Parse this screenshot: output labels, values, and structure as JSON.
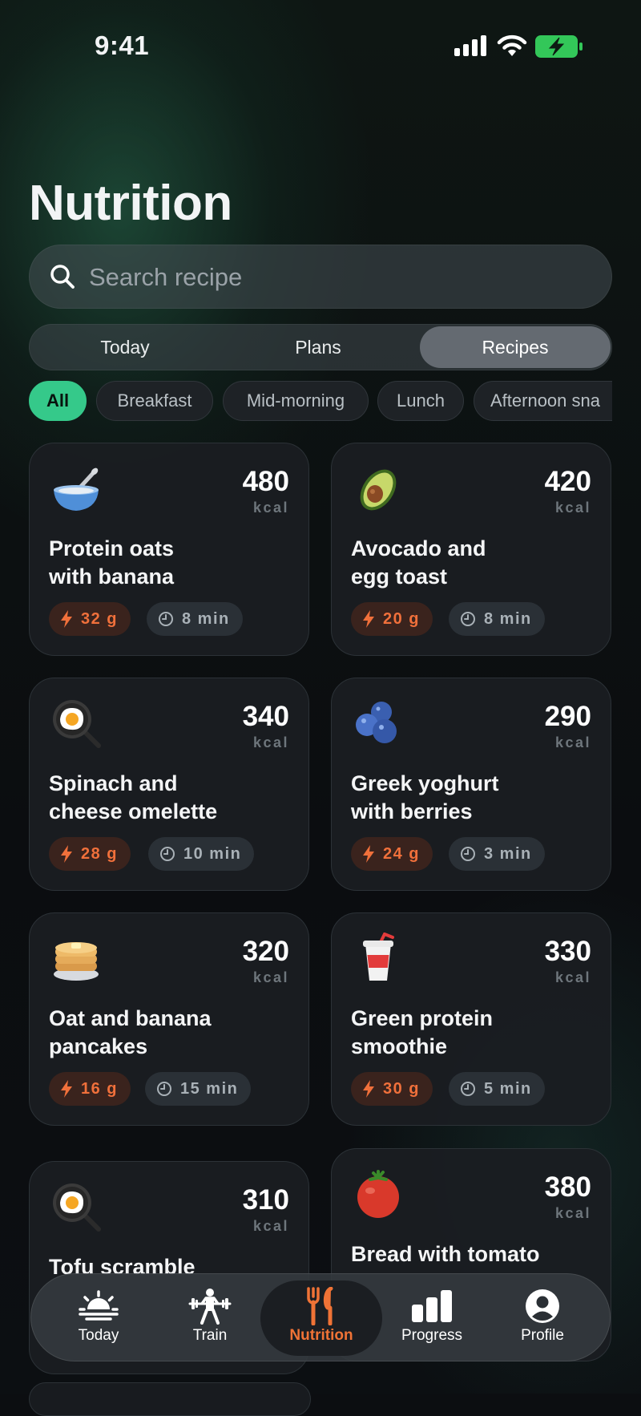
{
  "status_bar": {
    "time": "9:41",
    "icons": [
      "cellular-signal-icon",
      "wifi-icon",
      "battery-charging-icon"
    ],
    "battery_color": "#33c759"
  },
  "header": {
    "title": "Nutrition"
  },
  "search": {
    "placeholder": "Search recipe",
    "value": ""
  },
  "segments": {
    "items": [
      {
        "label": "Today",
        "selected": false
      },
      {
        "label": "Plans",
        "selected": false
      },
      {
        "label": "Recipes",
        "selected": true
      }
    ]
  },
  "filters": {
    "items": [
      {
        "label": "All",
        "selected": true
      },
      {
        "label": "Breakfast",
        "selected": false
      },
      {
        "label": "Mid-morning",
        "selected": false
      },
      {
        "label": "Lunch",
        "selected": false
      },
      {
        "label": "Afternoon sna",
        "selected": false
      }
    ]
  },
  "colors": {
    "accent_green": "#35c98a",
    "accent_orange": "#f0703b",
    "card_bg": "#1a1d21"
  },
  "recipes": [
    {
      "emoji": "🥣",
      "icon": "bowl-icon",
      "kcal": "480",
      "unit": "kcal",
      "title_line1": "Protein oats",
      "title_line2": "with banana",
      "protein": "32 g",
      "time": "8 min"
    },
    {
      "emoji": "🥑",
      "icon": "avocado-icon",
      "kcal": "420",
      "unit": "kcal",
      "title_line1": "Avocado and",
      "title_line2": "egg toast",
      "protein": "20 g",
      "time": "8 min"
    },
    {
      "emoji": "🍳",
      "icon": "frying-pan-egg-icon",
      "kcal": "340",
      "unit": "kcal",
      "title_line1": "Spinach and",
      "title_line2": "cheese omelette",
      "protein": "28 g",
      "time": "10 min"
    },
    {
      "emoji": "🫐",
      "icon": "blueberries-icon",
      "kcal": "290",
      "unit": "kcal",
      "title_line1": "Greek yoghurt",
      "title_line2": "with berries",
      "protein": "24 g",
      "time": "3 min"
    },
    {
      "emoji": "🥞",
      "icon": "pancakes-icon",
      "kcal": "320",
      "unit": "kcal",
      "title_line1": "Oat and banana",
      "title_line2": "pancakes",
      "protein": "16 g",
      "time": "15 min"
    },
    {
      "emoji": "🥤",
      "icon": "cup-with-straw-icon",
      "kcal": "330",
      "unit": "kcal",
      "title_line1": "Green protein",
      "title_line2": "smoothie",
      "protein": "30 g",
      "time": "5 min"
    },
    {
      "emoji": "🍳",
      "icon": "frying-pan-egg-icon",
      "kcal": "310",
      "unit": "kcal",
      "title_line1": "Tofu scramble",
      "title_line2": "",
      "protein": "",
      "time": ""
    },
    {
      "emoji": "🍅",
      "icon": "tomato-icon",
      "kcal": "380",
      "unit": "kcal",
      "title_line1": "Bread with tomato",
      "title_line2": "",
      "protein": "",
      "time": ""
    }
  ],
  "tab_bar": {
    "items": [
      {
        "label": "Today",
        "icon": "sunrise-icon",
        "selected": false
      },
      {
        "label": "Train",
        "icon": "weightlifter-icon",
        "selected": false
      },
      {
        "label": "Nutrition",
        "icon": "fork-knife-icon",
        "selected": true
      },
      {
        "label": "Progress",
        "icon": "bar-chart-icon",
        "selected": false
      },
      {
        "label": "Profile",
        "icon": "person-circle-icon",
        "selected": false
      }
    ]
  }
}
